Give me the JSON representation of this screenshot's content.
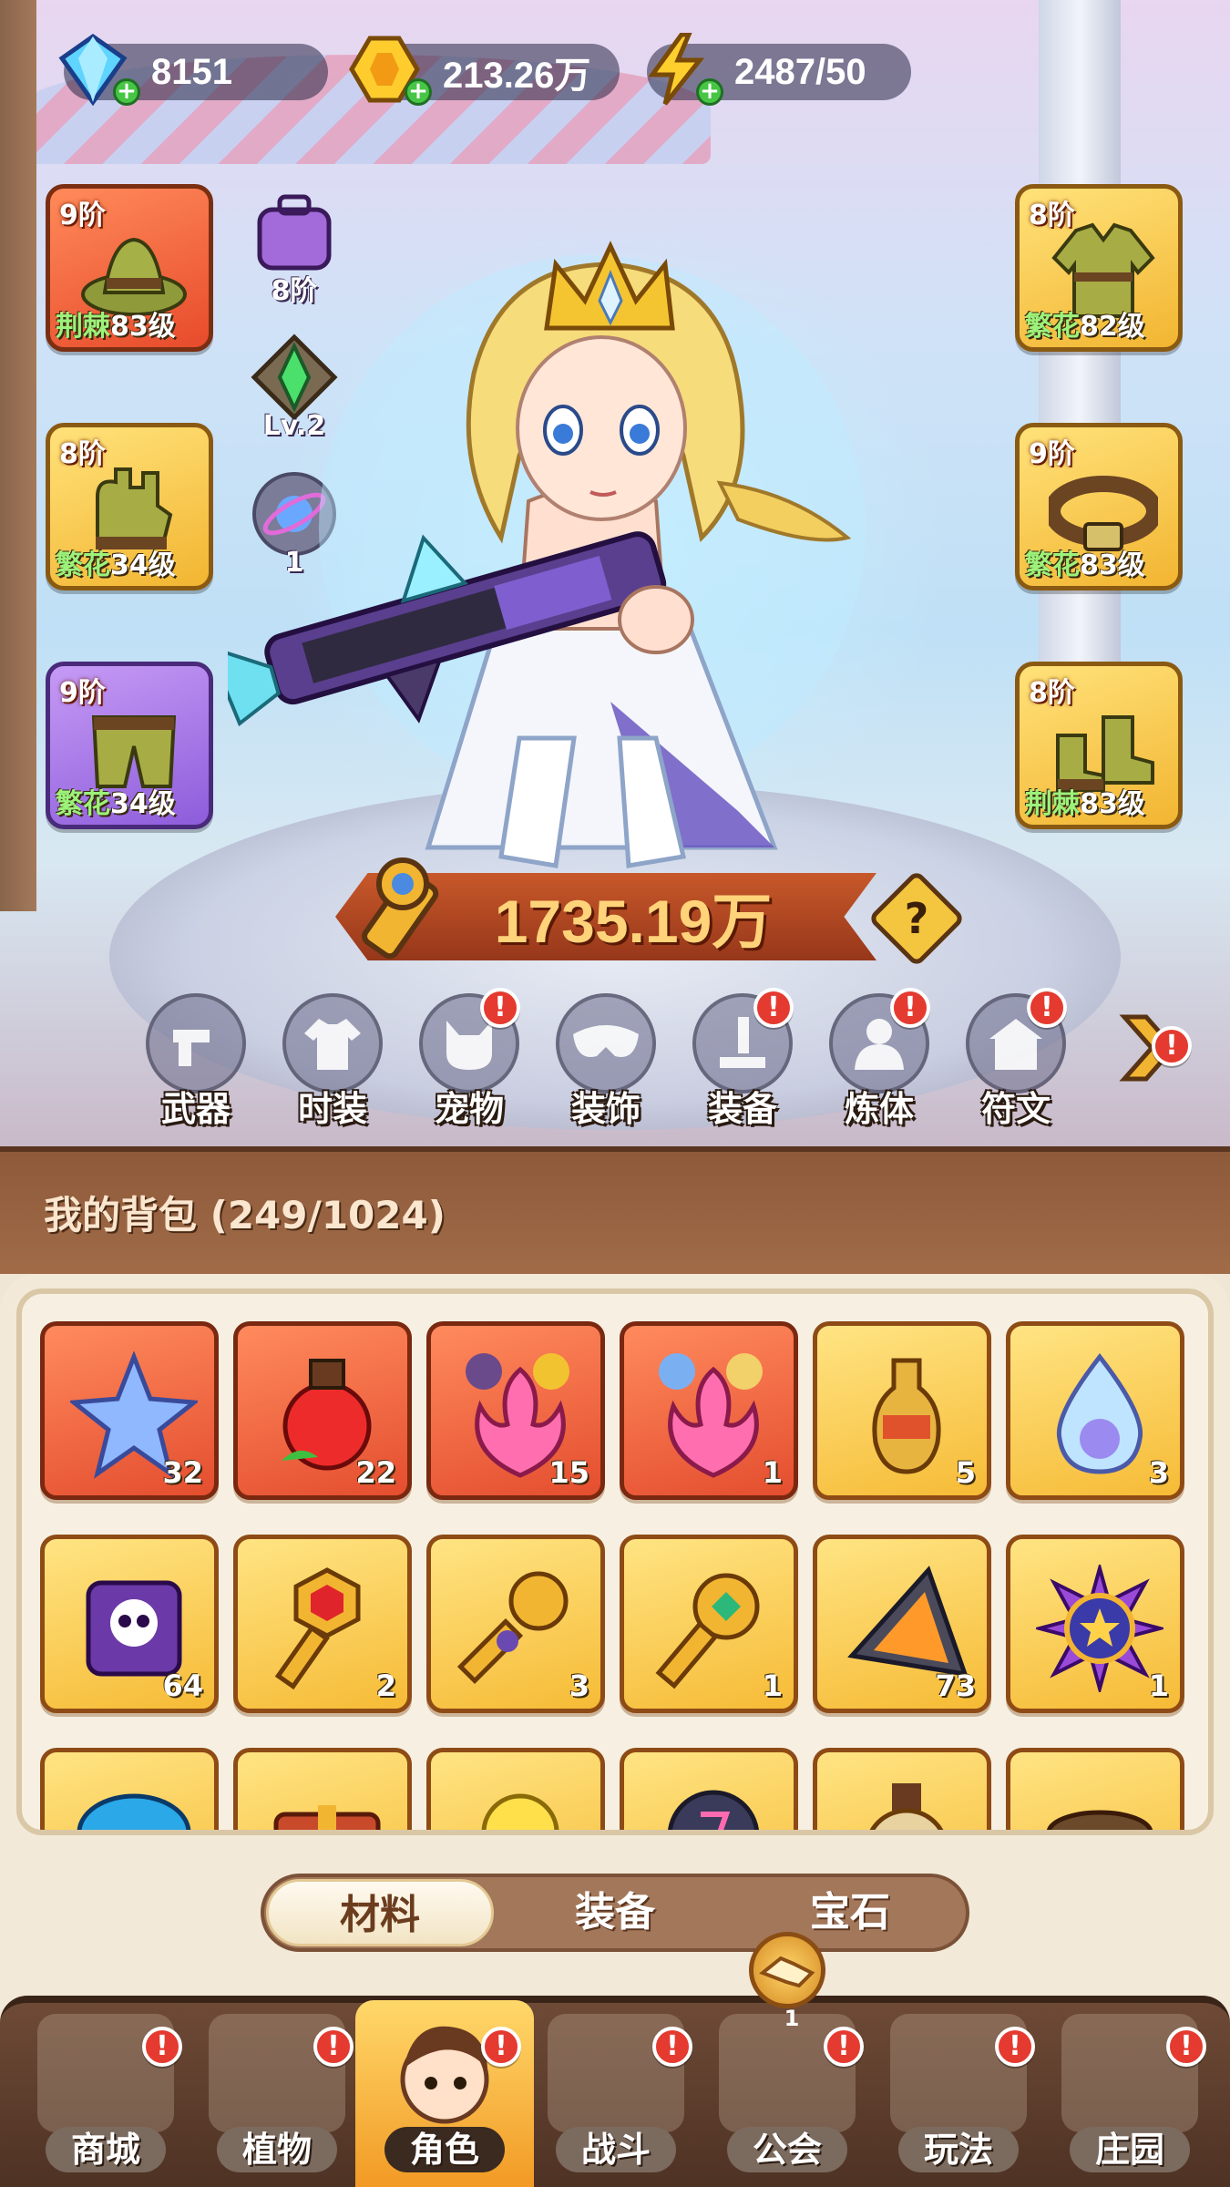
{
  "resources": {
    "diamond": {
      "value": "8151",
      "icon": "diamond-icon"
    },
    "gold": {
      "value": "213.26万",
      "icon": "gold-coin-icon"
    },
    "energy": {
      "value": "2487/50",
      "icon": "lightning-icon"
    }
  },
  "equipment_left": [
    {
      "tier": "9阶",
      "quality": "荆棘",
      "level": "83级",
      "item": "hat",
      "rarity": "red"
    },
    {
      "tier": "8阶",
      "quality": "繁花",
      "level": "34级",
      "item": "gloves",
      "rarity": "gold"
    },
    {
      "tier": "9阶",
      "quality": "繁花",
      "level": "34级",
      "item": "pants",
      "rarity": "purple"
    }
  ],
  "equipment_right": [
    {
      "tier": "8阶",
      "quality": "繁花",
      "level": "82级",
      "item": "jacket",
      "rarity": "gold"
    },
    {
      "tier": "9阶",
      "quality": "繁花",
      "level": "83级",
      "item": "belt",
      "rarity": "gold"
    },
    {
      "tier": "8阶",
      "quality": "荆棘",
      "level": "83级",
      "item": "boots",
      "rarity": "gold"
    }
  ],
  "mini_items": {
    "backpack": {
      "label": "8阶",
      "icon": "purple-backpack-icon"
    },
    "gem": {
      "label": "Lv.2",
      "icon": "green-gem-icon"
    },
    "orb": {
      "label": "1",
      "icon": "planet-orb-icon"
    }
  },
  "power": {
    "value": "1735.19万"
  },
  "help": "?",
  "features": [
    {
      "label": "武器",
      "icon": "weapon-icon",
      "alert": false
    },
    {
      "label": "时装",
      "icon": "fashion-icon",
      "alert": false
    },
    {
      "label": "宠物",
      "icon": "pet-icon",
      "alert": true
    },
    {
      "label": "装饰",
      "icon": "mask-icon",
      "alert": false
    },
    {
      "label": "装备",
      "icon": "equipment-icon",
      "alert": true
    },
    {
      "label": "炼体",
      "icon": "body-refine-icon",
      "alert": true
    },
    {
      "label": "符文",
      "icon": "rune-icon",
      "alert": true
    }
  ],
  "bag": {
    "title": "我的背包 (249/1024)"
  },
  "bag_items": [
    {
      "count": "32",
      "icon": "star-crystal-icon",
      "rarity": "red"
    },
    {
      "count": "22",
      "icon": "red-potion-apple-icon",
      "rarity": "red"
    },
    {
      "count": "15",
      "icon": "flame-flower-icon",
      "rarity": "red"
    },
    {
      "count": "1",
      "icon": "flame-flower-icon",
      "rarity": "red"
    },
    {
      "count": "5",
      "icon": "golden-vial-icon",
      "rarity": "gold"
    },
    {
      "count": "3",
      "icon": "water-drop-icon",
      "rarity": "gold"
    },
    {
      "count": "64",
      "icon": "skull-scroll-icon",
      "rarity": "gold"
    },
    {
      "count": "2",
      "icon": "ruby-key-icon",
      "rarity": "gold"
    },
    {
      "count": "3",
      "icon": "ornate-key-icon",
      "rarity": "gold"
    },
    {
      "count": "1",
      "icon": "emerald-key-icon",
      "rarity": "gold"
    },
    {
      "count": "73",
      "icon": "fire-prism-icon",
      "rarity": "gold"
    },
    {
      "count": "1",
      "icon": "star-orb-icon",
      "rarity": "gold"
    },
    {
      "count": "",
      "icon": "blue-mushroom-icon",
      "rarity": "gold"
    },
    {
      "count": "",
      "icon": "treasure-chest-icon",
      "rarity": "gold"
    },
    {
      "count": "",
      "icon": "yellow-flower-icon",
      "rarity": "gold"
    },
    {
      "count": "",
      "icon": "rune-stone-icon",
      "rarity": "gold"
    },
    {
      "count": "",
      "icon": "potion-bottle-icon",
      "rarity": "gold"
    },
    {
      "count": "",
      "icon": "soil-pot-icon",
      "rarity": "gold"
    }
  ],
  "bag_tabs": [
    {
      "label": "材料",
      "active": true
    },
    {
      "label": "装备",
      "active": false
    },
    {
      "label": "宝石",
      "active": false
    }
  ],
  "guild_badge_count": "1",
  "nav": [
    {
      "label": "商城",
      "icon": "shop-icon",
      "alert": true,
      "active": false
    },
    {
      "label": "植物",
      "icon": "plant-icon",
      "alert": true,
      "active": false
    },
    {
      "label": "角色",
      "icon": "character-icon",
      "alert": true,
      "active": true
    },
    {
      "label": "战斗",
      "icon": "battle-icon",
      "alert": true,
      "active": false
    },
    {
      "label": "公会",
      "icon": "guild-icon",
      "alert": true,
      "active": false
    },
    {
      "label": "玩法",
      "icon": "gameplay-icon",
      "alert": true,
      "active": false
    },
    {
      "label": "庄园",
      "icon": "manor-icon",
      "alert": true,
      "active": false
    }
  ],
  "alert_symbol": "!"
}
